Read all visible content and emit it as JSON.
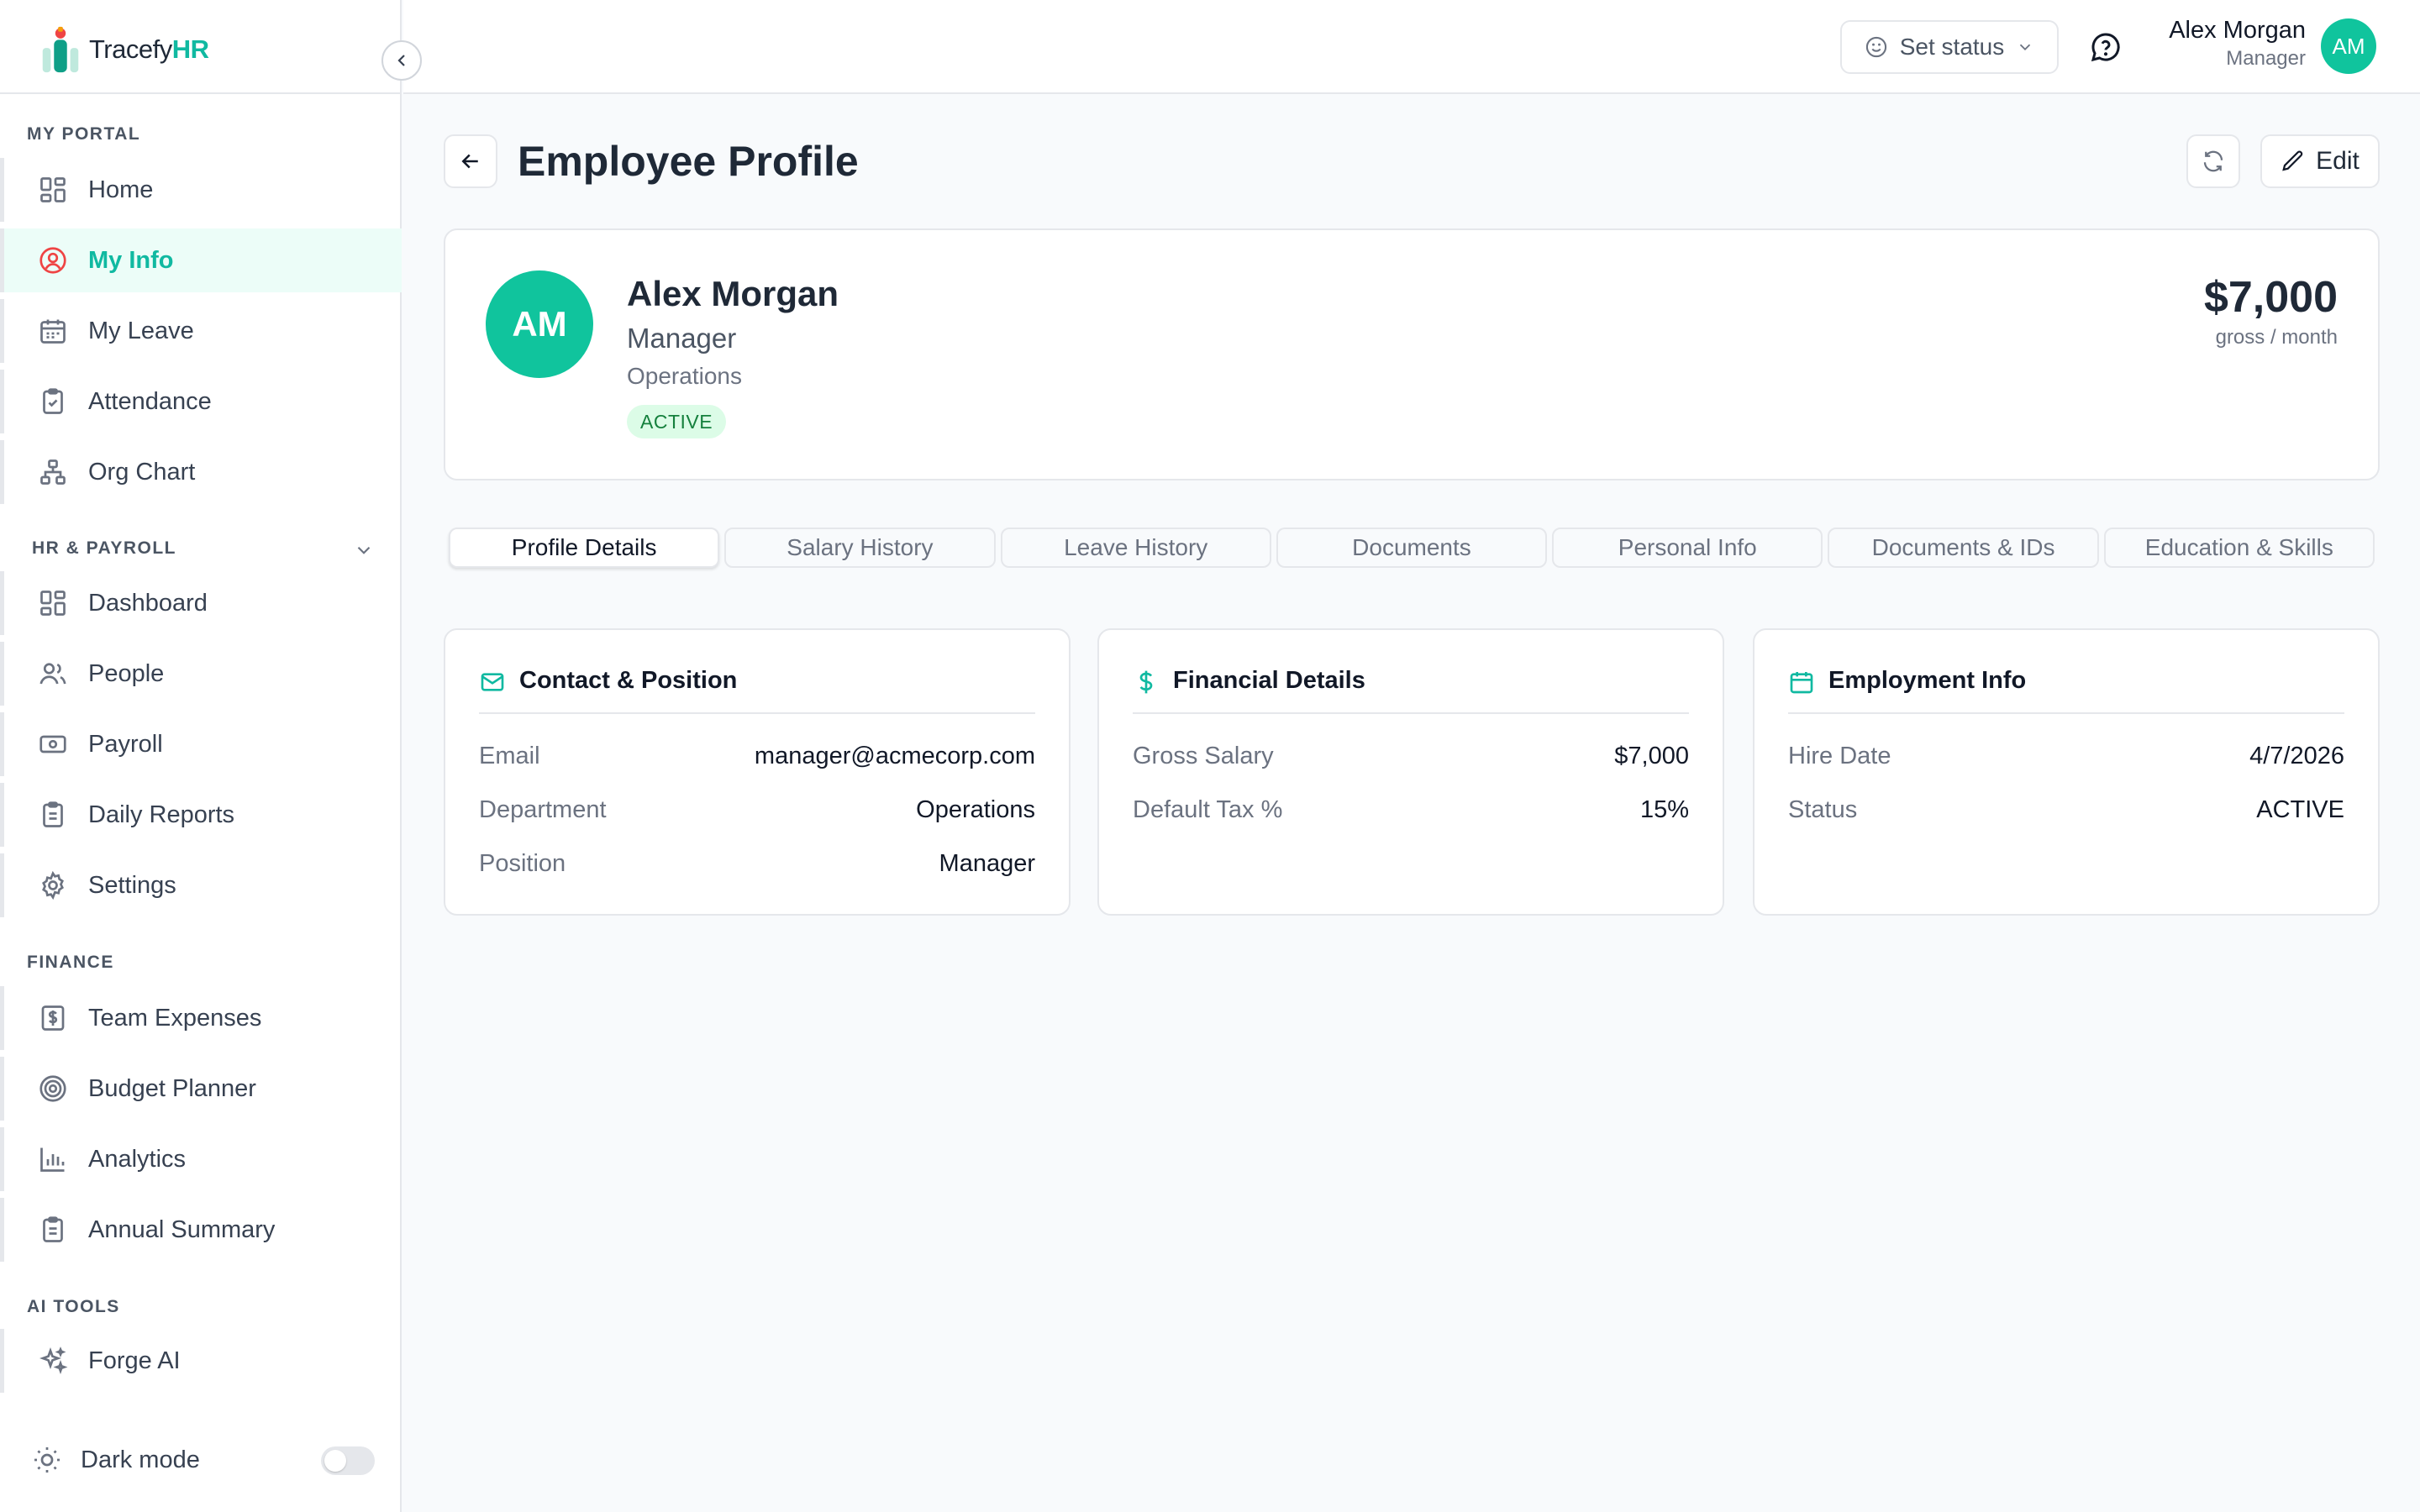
{
  "app": {
    "logo_prefix": "Tracefy",
    "logo_suffix": "HR",
    "brand_color": "#10b9a1"
  },
  "sidebar": {
    "sections": [
      {
        "label": "MY PORTAL",
        "items": [
          "Home",
          "My Info",
          "My Leave",
          "Attendance",
          "Org Chart"
        ]
      },
      {
        "label": "HR & PAYROLL",
        "items": [
          "Dashboard",
          "People",
          "Payroll",
          "Daily Reports",
          "Settings"
        ]
      },
      {
        "label": "FINANCE",
        "items": [
          "Team Expenses",
          "Budget Planner",
          "Analytics",
          "Annual Summary"
        ]
      },
      {
        "label": "AI TOOLS",
        "items": [
          "Forge AI"
        ]
      }
    ],
    "active_item": "My Info",
    "dark_mode_label": "Dark mode",
    "dark_mode_on": false
  },
  "topbar": {
    "set_status": "Set status",
    "user_name": "Alex Morgan",
    "user_role": "Manager",
    "avatar_initials": "AM"
  },
  "page": {
    "title": "Employee Profile",
    "edit_label": "Edit"
  },
  "profile": {
    "initials": "AM",
    "name": "Alex Morgan",
    "role": "Manager",
    "department": "Operations",
    "status": "ACTIVE",
    "salary": "$7,000",
    "salary_sub": "gross / month"
  },
  "tabs": [
    "Profile Details",
    "Salary History",
    "Leave History",
    "Documents",
    "Personal Info",
    "Documents & IDs",
    "Education & Skills"
  ],
  "active_tab": "Profile Details",
  "cards": {
    "contact": {
      "title": "Contact & Position",
      "rows": [
        {
          "k": "Email",
          "v": "manager@acmecorp.com"
        },
        {
          "k": "Department",
          "v": "Operations"
        },
        {
          "k": "Position",
          "v": "Manager"
        }
      ]
    },
    "financial": {
      "title": "Financial Details",
      "rows": [
        {
          "k": "Gross Salary",
          "v": "$7,000"
        },
        {
          "k": "Default Tax %",
          "v": "15%"
        }
      ]
    },
    "employment": {
      "title": "Employment Info",
      "rows": [
        {
          "k": "Hire Date",
          "v": "4/7/2026"
        },
        {
          "k": "Status",
          "v": "ACTIVE"
        }
      ]
    }
  }
}
